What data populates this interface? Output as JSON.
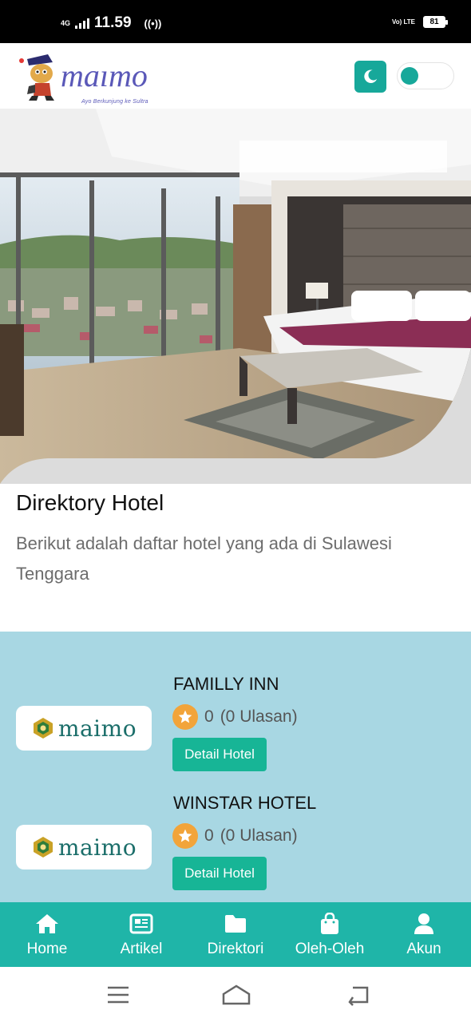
{
  "status_bar": {
    "network": "4G",
    "time": "11.59",
    "volte": "Vo) LTE",
    "battery": "81"
  },
  "header": {
    "logo_text": "maimo",
    "logo_tagline": "Ayo Berkunjung ke Sultra",
    "colors": {
      "accent": "#17a89a",
      "logo": "#5a58b8"
    }
  },
  "intro": {
    "title": "Direktory Hotel",
    "description": "Berikut adalah daftar hotel yang ada di Sulawesi Tenggara"
  },
  "hotels": [
    {
      "name": "FAMILLY INN",
      "logo_text": "maimo",
      "rating": "0",
      "reviews": "(0 Ulasan)",
      "button": "Detail Hotel"
    },
    {
      "name": "WINSTAR HOTEL",
      "logo_text": "maimo",
      "rating": "0",
      "reviews": "(0 Ulasan)",
      "button": "Detail Hotel"
    }
  ],
  "bottom_nav": [
    {
      "label": "Home",
      "icon": "home-icon"
    },
    {
      "label": "Artikel",
      "icon": "newspaper-icon"
    },
    {
      "label": "Direktori",
      "icon": "folder-icon"
    },
    {
      "label": "Oleh-Oleh",
      "icon": "shopping-bag-icon"
    },
    {
      "label": "Akun",
      "icon": "user-icon"
    }
  ]
}
